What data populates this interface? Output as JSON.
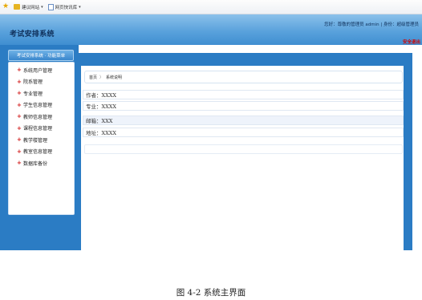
{
  "browser": {
    "favorites": [
      {
        "label": "建议网站",
        "icon": "folder-icon"
      },
      {
        "label": "网页快讯库",
        "icon": "page-icon"
      }
    ]
  },
  "header": {
    "title": "考试安排系统",
    "user_info": "您好：尊敬的管理员 admin | 身份：超级管理员",
    "safe_exit": "安全退出"
  },
  "sidebar": {
    "heading": "考试安排系统 · 功能菜单",
    "items": [
      {
        "label": "系统用户管理"
      },
      {
        "label": "院系管理"
      },
      {
        "label": "专业管理"
      },
      {
        "label": "学生信息管理"
      },
      {
        "label": "教师信息管理"
      },
      {
        "label": "课程信息管理"
      },
      {
        "label": "教学楼管理"
      },
      {
        "label": "教室信息管理"
      },
      {
        "label": "数据库备份"
      }
    ]
  },
  "main": {
    "breadcrumb": {
      "home": "首页",
      "separator": "〉",
      "current": "系统说明"
    },
    "rows": [
      {
        "text": "作者：XXXX"
      },
      {
        "text": "专业：XXXX"
      },
      {
        "text": "邮箱：XXX"
      },
      {
        "text": "地址：XXXX"
      }
    ]
  },
  "caption": "图 4-2 系统主界面",
  "colors": {
    "header": "#5aa2dc",
    "sidebar_bg": "#2b7cc4",
    "accent_red": "#d21a1a"
  }
}
